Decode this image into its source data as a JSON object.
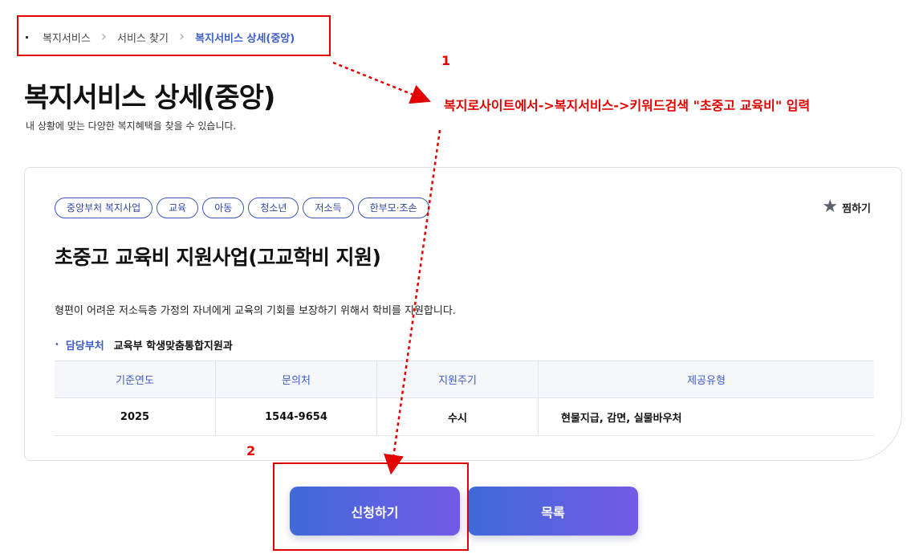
{
  "breadcrumb": {
    "items": [
      "복지서비스",
      "서비스 찾기",
      "복지서비스 상세(중앙)"
    ]
  },
  "page": {
    "title": "복지서비스 상세(중앙)",
    "subtitle": "내 상황에 맞는 다양한 복지혜택을 찾을 수 있습니다."
  },
  "annotations": {
    "step1_number": "1",
    "step2_number": "2",
    "instruction": "복지로사이트에서->복지서비스->키워드검색 \"초중고 교육비\" 입력",
    "color": "#e30000"
  },
  "service": {
    "tags": [
      "중앙부처 복지사업",
      "교육",
      "아동",
      "청소년",
      "저소득",
      "한부모·조손"
    ],
    "bookmark_label": "찜하기",
    "title": "초중고 교육비 지원사업(고교학비 지원)",
    "description": "형편이 어려운 저소득층 가정의 자녀에게 교육의 기회를 보장하기 위해서 학비를 지원합니다.",
    "dept_label": "담당부처",
    "dept_value": "교육부 학생맞춤통합지원과",
    "table": {
      "headers": [
        "기준연도",
        "문의처",
        "지원주기",
        "제공유형"
      ],
      "row": [
        "2025",
        "1544-9654",
        "수시",
        "현물지급, 감면, 실물바우처"
      ]
    }
  },
  "buttons": {
    "apply": "신청하기",
    "list": "목록"
  },
  "colors": {
    "accent": "#3b5bc9",
    "button_gradient_start": "#3f6ad8",
    "button_gradient_end": "#735ae6"
  }
}
